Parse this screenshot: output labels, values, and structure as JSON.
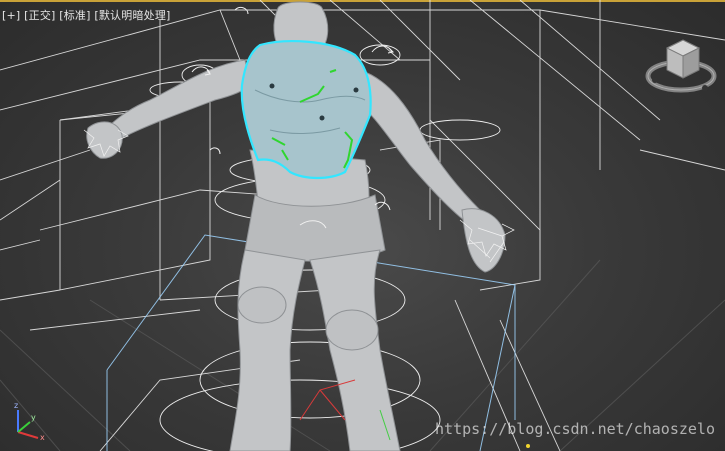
{
  "viewport": {
    "menu_plus": "+",
    "menu_projection": "正交",
    "menu_shading_mode": "标准",
    "menu_lighting": "默认明暗处理",
    "bracket_open": "[",
    "bracket_close": "]"
  },
  "axis_tripod": {
    "x_label": "x",
    "y_label": "y",
    "z_label": "z"
  },
  "watermark": {
    "text": "https://blog.csdn.net/chaoszelo"
  },
  "colors": {
    "viewport_bg": "#3a3a3a",
    "wireframe": "#e8e8e8",
    "selection_highlight": "#33e6ff",
    "bone_highlight": "#2fd62f",
    "mesh_gray": "#c4c6c8",
    "selected_mesh": "#a9c7cf",
    "active_frame_border": "#c9a238"
  },
  "icons": [
    "viewcube-icon",
    "axis-tripod-icon"
  ]
}
